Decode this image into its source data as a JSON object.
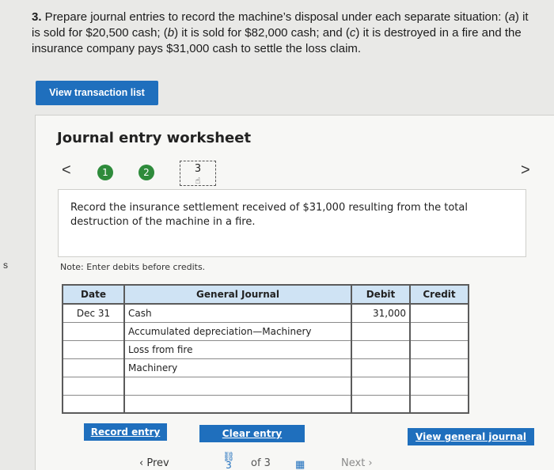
{
  "left_margin_letter": "s",
  "question": {
    "number": "3.",
    "text_before_a": " Prepare journal entries to record the machine’s disposal under each separate situation: (",
    "a": "a",
    "text_after_a": ") it is sold for $20,500 cash; (",
    "b": "b",
    "text_after_b": ") it is sold for $82,000 cash; and (",
    "c": "c",
    "text_after_c": ") it is destroyed in a fire and the insurance company pays $31,000 cash to settle the loss claim."
  },
  "view_transaction_list_label": "View transaction list",
  "worksheet": {
    "title": "Journal entry worksheet",
    "prev_arrow": "<",
    "next_arrow": ">",
    "steps": [
      "1",
      "2",
      "3"
    ],
    "instruction": "Record the insurance settlement received of $31,000 resulting from the total destruction of the machine in a fire.",
    "note": "Note: Enter debits before credits."
  },
  "journal": {
    "headers": {
      "date": "Date",
      "general_journal": "General Journal",
      "debit": "Debit",
      "credit": "Credit"
    },
    "rows": [
      {
        "date": "Dec 31",
        "account": "Cash",
        "debit": "31,000",
        "credit": ""
      },
      {
        "date": "",
        "account": "Accumulated depreciation—Machinery",
        "debit": "",
        "credit": ""
      },
      {
        "date": "",
        "account": "Loss from fire",
        "debit": "",
        "credit": ""
      },
      {
        "date": "",
        "account": "Machinery",
        "debit": "",
        "credit": ""
      },
      {
        "date": "",
        "account": "",
        "debit": "",
        "credit": ""
      },
      {
        "date": "",
        "account": "",
        "debit": "",
        "credit": ""
      }
    ]
  },
  "buttons": {
    "record_entry": "Record entry",
    "clear_entry": "Clear entry",
    "view_general_journal": "View general journal"
  },
  "pager": {
    "prev": "Prev",
    "current": "3",
    "of": "of 3",
    "next": "Next"
  },
  "colors": {
    "accent_blue": "#1f6fbd",
    "step_done_green": "#2e8b3b",
    "table_header_bg": "#cfe3f4"
  }
}
